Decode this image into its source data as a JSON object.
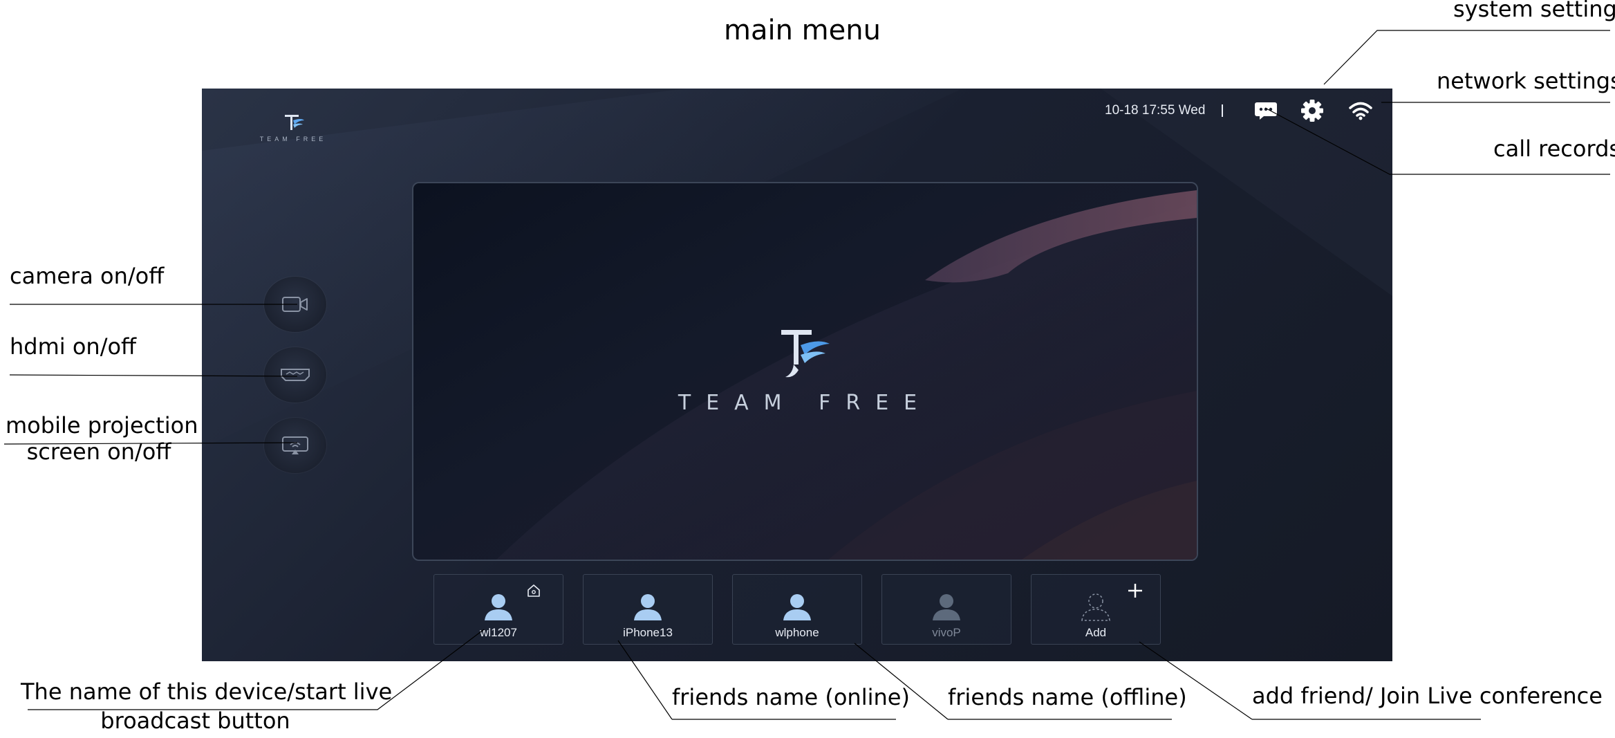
{
  "page_title": "main menu",
  "annotations": {
    "system_settings": "system settings",
    "network_settings": "network settings",
    "call_records": "call records",
    "camera": "camera on/off",
    "hdmi": "hdmi on/off",
    "mobile_line1": "mobile projection",
    "mobile_line2": "screen on/off",
    "device_line1": "The name of this device/start live",
    "device_line2": "broadcast button",
    "friends_online": "friends name (online)",
    "friends_offline": "friends name (offline)",
    "add_friend": "add friend/ Join Live conference"
  },
  "screen": {
    "brand_small": "TEAM FREE",
    "brand_large": "TEAM FREE",
    "status": {
      "datetime": "10-18 17:55 Wed",
      "icons": [
        "message-icon",
        "gear-icon",
        "wifi-icon"
      ]
    },
    "side_buttons": [
      "camera-icon",
      "hdmi-icon",
      "screen-projection-icon"
    ],
    "tiles": [
      {
        "label": "wl1207",
        "state": "self"
      },
      {
        "label": "iPhone13",
        "state": "online"
      },
      {
        "label": "wlphone",
        "state": "online"
      },
      {
        "label": "vivoP",
        "state": "offline"
      },
      {
        "label": "Add",
        "state": "add"
      }
    ]
  },
  "colors": {
    "screen_bg": "#1a2030",
    "accent_blue": "#5ea8f0",
    "text_light": "#e8ecf4",
    "text_dim": "#7f8898"
  }
}
